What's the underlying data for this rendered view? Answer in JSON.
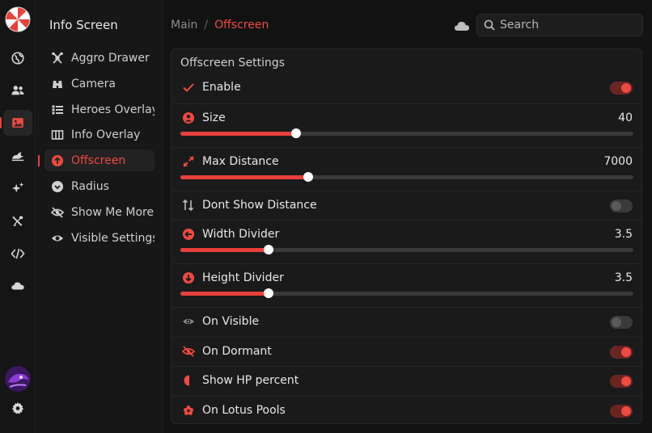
{
  "rail": {
    "items": [
      {
        "icon": "globe-icon",
        "active": false
      },
      {
        "icon": "users-icon",
        "active": false
      },
      {
        "icon": "image-icon",
        "active": true
      },
      {
        "icon": "hero-icon",
        "active": false
      },
      {
        "icon": "sparkles-icon",
        "active": false
      },
      {
        "icon": "tools-icon",
        "active": false
      },
      {
        "icon": "code-icon",
        "active": false
      },
      {
        "icon": "cloud-icon",
        "active": false
      }
    ]
  },
  "sidebar": {
    "title": "Info Screen",
    "items": [
      {
        "label": "Aggro Drawer",
        "icon": "drone-icon"
      },
      {
        "label": "Camera",
        "icon": "binoculars-icon"
      },
      {
        "label": "Heroes Overlay",
        "icon": "list-icon"
      },
      {
        "label": "Info Overlay",
        "icon": "columns-icon"
      },
      {
        "label": "Offscreen",
        "icon": "arrow-up-circle-icon"
      },
      {
        "label": "Radius",
        "icon": "chevron-circle-icon"
      },
      {
        "label": "Show Me More",
        "icon": "eye-off-icon"
      },
      {
        "label": "Visible Settings",
        "icon": "eye-icon"
      }
    ]
  },
  "breadcrumb": {
    "root": "Main",
    "separator": "/",
    "current": "Offscreen"
  },
  "search": {
    "placeholder": "Search"
  },
  "panel": {
    "title": "Offscreen Settings",
    "rows": [
      {
        "label": "Enable",
        "icon": "check-icon",
        "type": "toggle",
        "on": true
      },
      {
        "label": "Size",
        "icon": "user-circle-icon",
        "type": "slider",
        "value": "40",
        "fraction": 0.255
      },
      {
        "label": "Max Distance",
        "icon": "expand-icon",
        "type": "slider",
        "value": "7000",
        "fraction": 0.283
      },
      {
        "label": "Dont Show Distance",
        "icon": "sort-icon",
        "type": "toggle",
        "on": false
      },
      {
        "label": "Width Divider",
        "icon": "arrow-left-circle-icon",
        "type": "slider",
        "value": "3.5",
        "fraction": 0.194
      },
      {
        "label": "Height Divider",
        "icon": "arrow-down-circle-icon",
        "type": "slider",
        "value": "3.5",
        "fraction": 0.194
      },
      {
        "label": "On Visible",
        "icon": "eye-icon",
        "type": "toggle",
        "on": false
      },
      {
        "label": "On Dormant",
        "icon": "eye-off-icon",
        "type": "toggle",
        "on": true
      },
      {
        "label": "Show HP percent",
        "icon": "half-circle-icon",
        "type": "toggle",
        "on": true
      },
      {
        "label": "On Lotus Pools",
        "icon": "lotus-icon",
        "type": "toggle",
        "on": true
      }
    ]
  },
  "colors": {
    "accent": "#ef4a40",
    "background": "#121212",
    "panel": "#1a1a1a"
  }
}
